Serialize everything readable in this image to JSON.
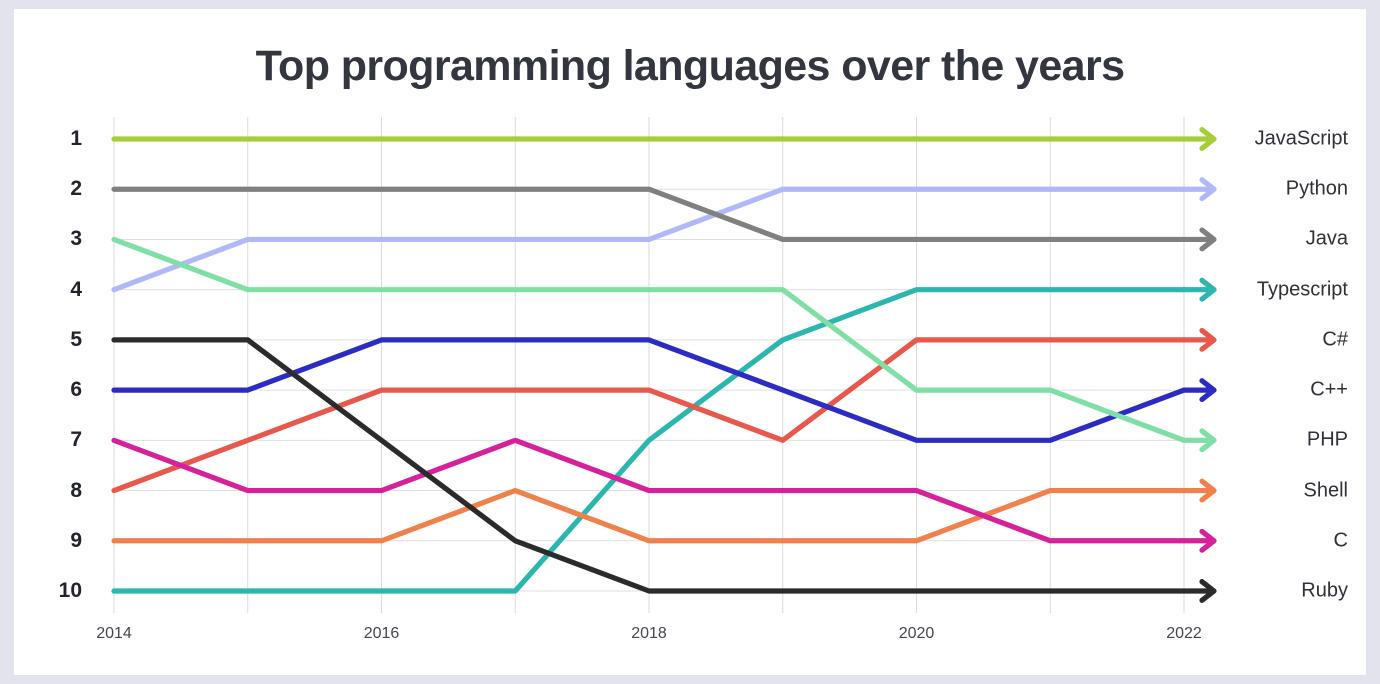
{
  "card": {
    "background": "#ffffff",
    "page_background": "#e3e3ee"
  },
  "header": {
    "title": "Top programming languages over the years"
  },
  "axes": {
    "y_label_color": "#22242b",
    "x_label_color": "#44464e",
    "grid_color": "#d5d5d8",
    "y_ticks": [
      "1",
      "2",
      "3",
      "4",
      "5",
      "6",
      "7",
      "8",
      "9",
      "10"
    ],
    "x_ticks": [
      "2014",
      "2016",
      "2018",
      "2020",
      "2022"
    ],
    "x_tick_years": [
      2014,
      2016,
      2018,
      2020,
      2022
    ]
  },
  "chart_data": {
    "type": "line",
    "title": "Top programming languages over the years",
    "xlabel": "",
    "ylabel": "",
    "x": [
      2014,
      2015,
      2016,
      2017,
      2018,
      2019,
      2020,
      2021,
      2022
    ],
    "ylim": [
      1,
      10
    ],
    "y_inverted": true,
    "grid": true,
    "legend_position": "right-end-labels",
    "note": "Y axis is rank: 1 = highest / best.",
    "series": [
      {
        "name": "JavaScript",
        "color": "#a7ce3a",
        "values": [
          1,
          1,
          1,
          1,
          1,
          1,
          1,
          1,
          1
        ]
      },
      {
        "name": "Python",
        "color": "#b0b8fa",
        "values": [
          4,
          3,
          3,
          3,
          3,
          2,
          2,
          2,
          2
        ]
      },
      {
        "name": "Java",
        "color": "#808080",
        "values": [
          2,
          2,
          2,
          2,
          2,
          3,
          3,
          3,
          3
        ]
      },
      {
        "name": "Typescript",
        "color": "#2bb6ae",
        "values": [
          10,
          10,
          10,
          10,
          7,
          5,
          4,
          4,
          4
        ]
      },
      {
        "name": "C#",
        "color": "#e8584c",
        "values": [
          8,
          7,
          6,
          6,
          6,
          7,
          5,
          5,
          5
        ]
      },
      {
        "name": "C++",
        "color": "#2c2cc4",
        "values": [
          6,
          6,
          5,
          5,
          5,
          6,
          7,
          7,
          6
        ]
      },
      {
        "name": "PHP",
        "color": "#7fdfa6",
        "values": [
          3,
          4,
          4,
          4,
          4,
          4,
          6,
          6,
          7
        ]
      },
      {
        "name": "Shell",
        "color": "#f0814c",
        "values": [
          9,
          9,
          9,
          8,
          9,
          9,
          9,
          8,
          8
        ]
      },
      {
        "name": "C",
        "color": "#d6219a",
        "values": [
          7,
          8,
          8,
          7,
          8,
          8,
          8,
          9,
          9
        ]
      },
      {
        "name": "Ruby",
        "color": "#2b2b2b",
        "values": [
          5,
          5,
          7,
          9,
          10,
          10,
          10,
          10,
          10
        ]
      }
    ]
  },
  "series_labels": [
    {
      "name": "JavaScript"
    },
    {
      "name": "Python"
    },
    {
      "name": "Java"
    },
    {
      "name": "Typescript"
    },
    {
      "name": "C#"
    },
    {
      "name": "C++"
    },
    {
      "name": "PHP"
    },
    {
      "name": "Shell"
    },
    {
      "name": "C"
    },
    {
      "name": "Ruby"
    }
  ]
}
